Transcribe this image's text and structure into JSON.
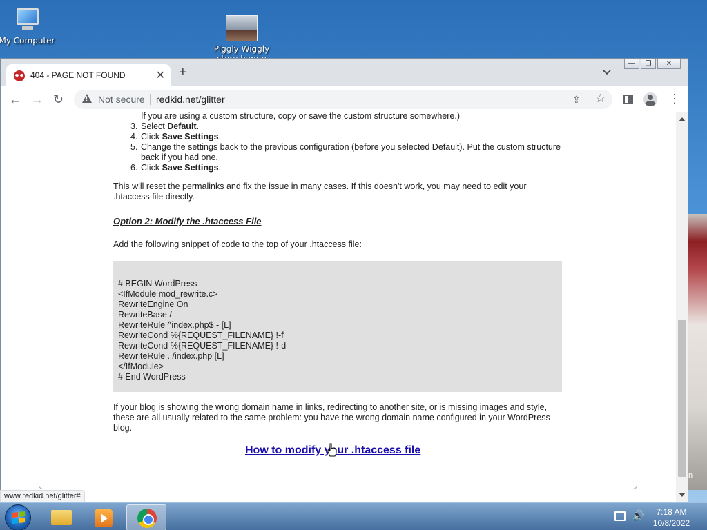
{
  "desktop": {
    "icons": [
      {
        "label": "My Computer"
      },
      {
        "label": "Piggly Wiggly store banne"
      }
    ],
    "edge_text": "n"
  },
  "browser": {
    "tab": {
      "title": "404 - PAGE NOT FOUND",
      "close": "✕"
    },
    "new_tab": "+",
    "window_controls": {
      "minimize": "—",
      "restore": "❐",
      "close": "✕"
    },
    "toolbar": {
      "back": "←",
      "forward": "→",
      "reload": "↻",
      "security_label": "Not secure",
      "url": "redkid.net/glitter",
      "share_icon": "⇪",
      "star_icon": "☆",
      "menu_icon": "⋮"
    },
    "status_url": "www.redkid.net/glitter#"
  },
  "page": {
    "steps": [
      {
        "num": "",
        "html_text": "If you are using a custom structure, copy or save the custom structure somewhere.)"
      },
      {
        "num": "3.",
        "pre": "Select ",
        "bold": "Default",
        "post": "."
      },
      {
        "num": "4.",
        "pre": "Click ",
        "bold": "Save Settings",
        "post": "."
      },
      {
        "num": "5.",
        "pre": "Change the settings back to the previous configuration (before you selected Default). Put the custom structure back if you had one.",
        "bold": "",
        "post": ""
      },
      {
        "num": "6.",
        "pre": "Click ",
        "bold": "Save Settings",
        "post": "."
      }
    ],
    "para_reset": "This will reset the permalinks and fix the issue in many cases. If this doesn't work, you may need to edit your .htaccess file directly.",
    "option2_heading": "Option 2: Modify the .htaccess File",
    "para_snippet": "Add the following snippet of code to the top of your .htaccess file:",
    "code_lines": [
      "# BEGIN WordPress",
      "<IfModule mod_rewrite.c>",
      "RewriteEngine On",
      "RewriteBase /",
      "RewriteRule ^index.php$ - [L]",
      "RewriteCond %{REQUEST_FILENAME} !-f",
      "RewriteCond %{REQUEST_FILENAME} !-d",
      "RewriteRule . /index.php [L]",
      "</IfModule>",
      "# End WordPress"
    ],
    "para_domain": "If your blog is showing the wrong domain name in links, redirecting to another site, or is missing images and style, these are all usually related to the same problem: you have the wrong domain name configured in your WordPress blog.",
    "howto_link": "How to modify your .htaccess file"
  },
  "taskbar": {
    "apps": [
      "windows-explorer",
      "windows-media-player",
      "google-chrome"
    ],
    "clock_time": "7:18 AM",
    "clock_date": "10/8/2022"
  },
  "colors": {
    "link": "#1a0dab",
    "code_bg": "#e0e0e0",
    "favicon_red": "#c62828"
  }
}
